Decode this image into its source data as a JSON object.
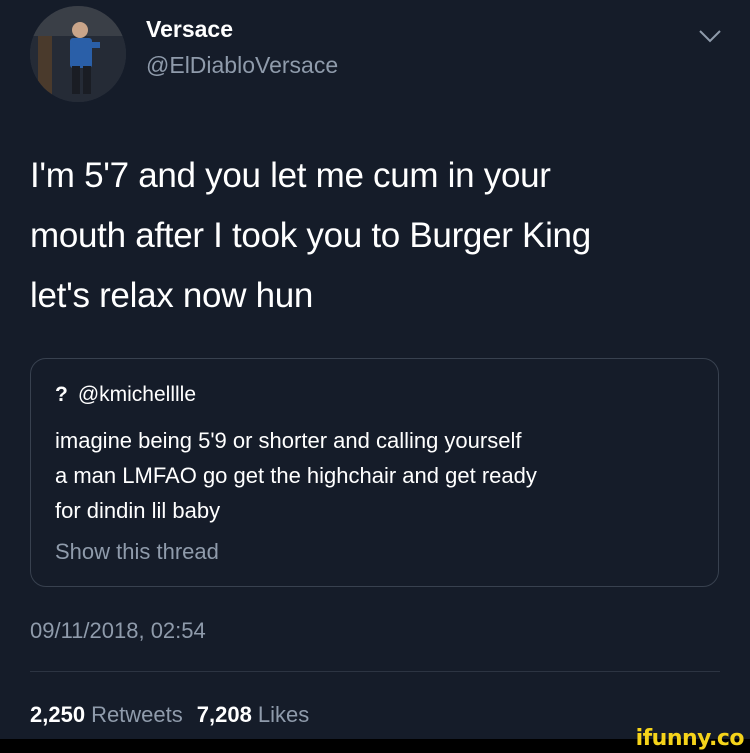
{
  "author": {
    "display_name": "Versace",
    "handle": "@ElDiabloVersace"
  },
  "tweet": {
    "lines": [
      "I'm 5'7 and you let me cum in your",
      "mouth after I took you to Burger King",
      "let's relax now hun"
    ]
  },
  "quoted_tweet": {
    "marker": "?",
    "handle": "@kmichelllle",
    "lines": [
      "imagine being 5'9 or shorter and calling yourself",
      "a man LMFAO go get the highchair and get ready",
      "for dindin lil baby"
    ],
    "show_thread": "Show this thread"
  },
  "timestamp": "09/11/2018, 02:54",
  "stats": {
    "retweets_count": "2,250",
    "retweets_label": "Retweets",
    "likes_count": "7,208",
    "likes_label": "Likes"
  },
  "watermark": "ifunny.co",
  "colors": {
    "background": "#151c29",
    "secondary_text": "#8f9bab",
    "watermark": "#f5d31a"
  }
}
